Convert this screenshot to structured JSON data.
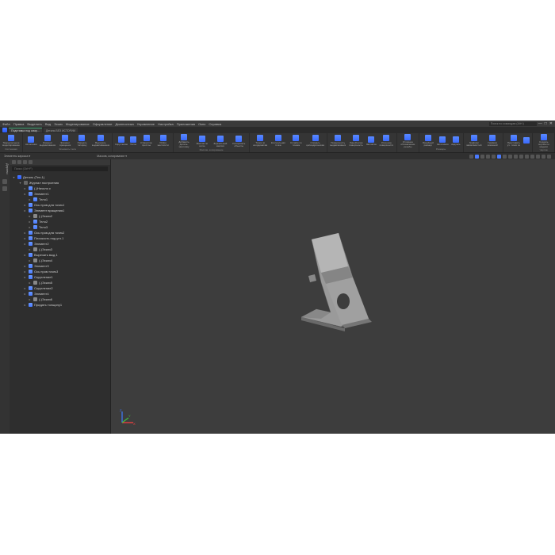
{
  "menubar": {
    "items": [
      "Файл",
      "Правка",
      "Выделить",
      "Вид",
      "Эскиз",
      "Моделирование",
      "Оформление",
      "Диагностика",
      "Управление",
      "Настройка",
      "Приложения",
      "Окно",
      "Справка"
    ],
    "search_placeholder": "Поиск по командам (Alt+/)"
  },
  "tabs": {
    "active": "Подставка под смар...",
    "inactive": "Деталь БЕЗ ИСТОРИИ"
  },
  "ribbon": {
    "groups": [
      {
        "label": "Системная",
        "buttons": [
          {
            "label": "Твердотельное\nмоделирование"
          }
        ]
      },
      {
        "label": "Элементы тела",
        "buttons": [
          {
            "label": "Автопиния"
          },
          {
            "label": "Элемент\nвыдавливания"
          },
          {
            "label": "Элемент\nвращения"
          },
          {
            "label": "Придать\nтолщину"
          },
          {
            "label": "Вырезать\nвыдавливанием"
          }
        ]
      },
      {
        "label": "",
        "buttons": [
          {
            "label": "Скругление"
          },
          {
            "label": "Уклон"
          },
          {
            "label": "Отверстие\nпростое"
          },
          {
            "label": "Ребро\nжесткости"
          }
        ]
      },
      {
        "label": "Массив, копирование",
        "buttons": [
          {
            "label": "Добавить\nдеталь-заготовку"
          },
          {
            "label": "Массив по\nсетке"
          },
          {
            "label": "Зеркальный\nмассив"
          },
          {
            "label": "Копировать\nобъекты"
          }
        ]
      },
      {
        "label": "",
        "buttons": [
          {
            "label": "Точка по\nкоординатам"
          },
          {
            "label": "Контрольная\nточка"
          },
          {
            "label": "Сплайн по\nточкам"
          },
          {
            "label": "Спираль\nцилиндрическая"
          }
        ]
      },
      {
        "label": "",
        "buttons": [
          {
            "label": "Поверхность\nвыдавливания"
          },
          {
            "label": "Линейчатая\nповерхность"
          },
          {
            "label": "Заплатка"
          },
          {
            "label": "Усечение\nповерхности"
          }
        ]
      },
      {
        "label": "",
        "buttons": [
          {
            "label": "Условное\nобозначение\nрезьбы"
          }
        ]
      },
      {
        "label": "Размеры",
        "buttons": [
          {
            "label": "Линейный\nразмер"
          },
          {
            "label": "Автолиния"
          },
          {
            "label": "Надпись"
          }
        ]
      },
      {
        "label": "",
        "buttons": [
          {
            "label": "Графики\nзависимостей"
          },
          {
            "label": "Графики\nзначений"
          }
        ]
      },
      {
        "label": "",
        "buttons": [
          {
            "label": "Проставить уч.\nточки по"
          },
          {
            "label": ""
          }
        ]
      },
      {
        "label": "Чертёж",
        "buttons": [
          {
            "label": "Создать чертёж\nпо модели"
          }
        ]
      }
    ]
  },
  "subtoolbar": {
    "left_label": "Элементы каркаса ▾",
    "right_label": "Массив, копирование ▾"
  },
  "sidebar": {
    "tab_label": "Дерево",
    "search_placeholder": "Поиск (Ctrl+F)",
    "root": "Деталь (Тел-1)",
    "history": "Журнал построения",
    "items": [
      {
        "label": "(-)Начало к",
        "indent": 14
      },
      {
        "label": "Элемент1",
        "indent": 14
      },
      {
        "label": "Тело1",
        "indent": 20
      },
      {
        "label": "Ось пров.для точек1",
        "indent": 14
      },
      {
        "label": "Элемент вращения1",
        "indent": 14
      },
      {
        "label": "(-)Эскиз2",
        "indent": 20
      },
      {
        "label": "Тело2",
        "indent": 20
      },
      {
        "label": "Тело3",
        "indent": 20
      },
      {
        "label": "Ось пров.для точек2",
        "indent": 14
      },
      {
        "label": "Плоскость под угл.1",
        "indent": 14
      },
      {
        "label": "Элемент2",
        "indent": 14
      },
      {
        "label": "(-)Эскиз3",
        "indent": 20
      },
      {
        "label": "Вырезать выд.1",
        "indent": 14
      },
      {
        "label": "(-)Эскиз4",
        "indent": 20
      },
      {
        "label": "Элемент3",
        "indent": 14
      },
      {
        "label": "Ось пров.точек3",
        "indent": 14
      },
      {
        "label": "Скругление1",
        "indent": 14
      },
      {
        "label": "(-)Эскиз5",
        "indent": 20
      },
      {
        "label": "Скругление2",
        "indent": 14
      },
      {
        "label": "Элемент4",
        "indent": 14
      },
      {
        "label": "(-)Эскиз6",
        "indent": 20
      },
      {
        "label": "Придать толщину1",
        "indent": 14
      }
    ]
  },
  "axis": {
    "x": "X",
    "y": "Y",
    "z": "Z"
  }
}
